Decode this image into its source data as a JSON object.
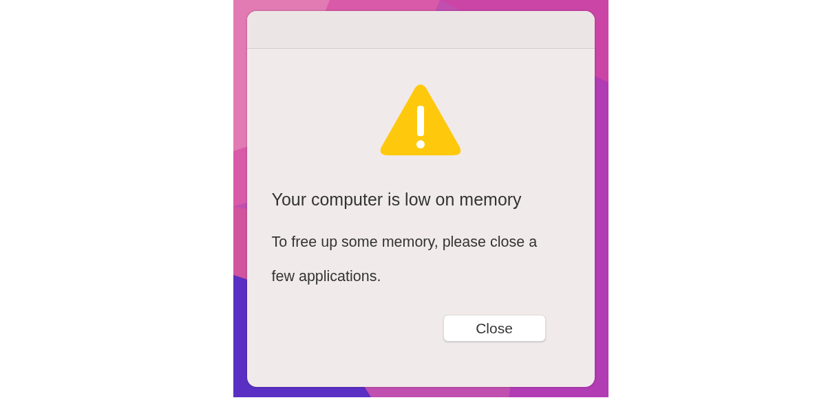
{
  "dialog": {
    "title": "Your computer is low on memory",
    "message": "To free up some memory, please close a few applications.",
    "buttons": [
      {
        "label": "Close"
      }
    ]
  }
}
